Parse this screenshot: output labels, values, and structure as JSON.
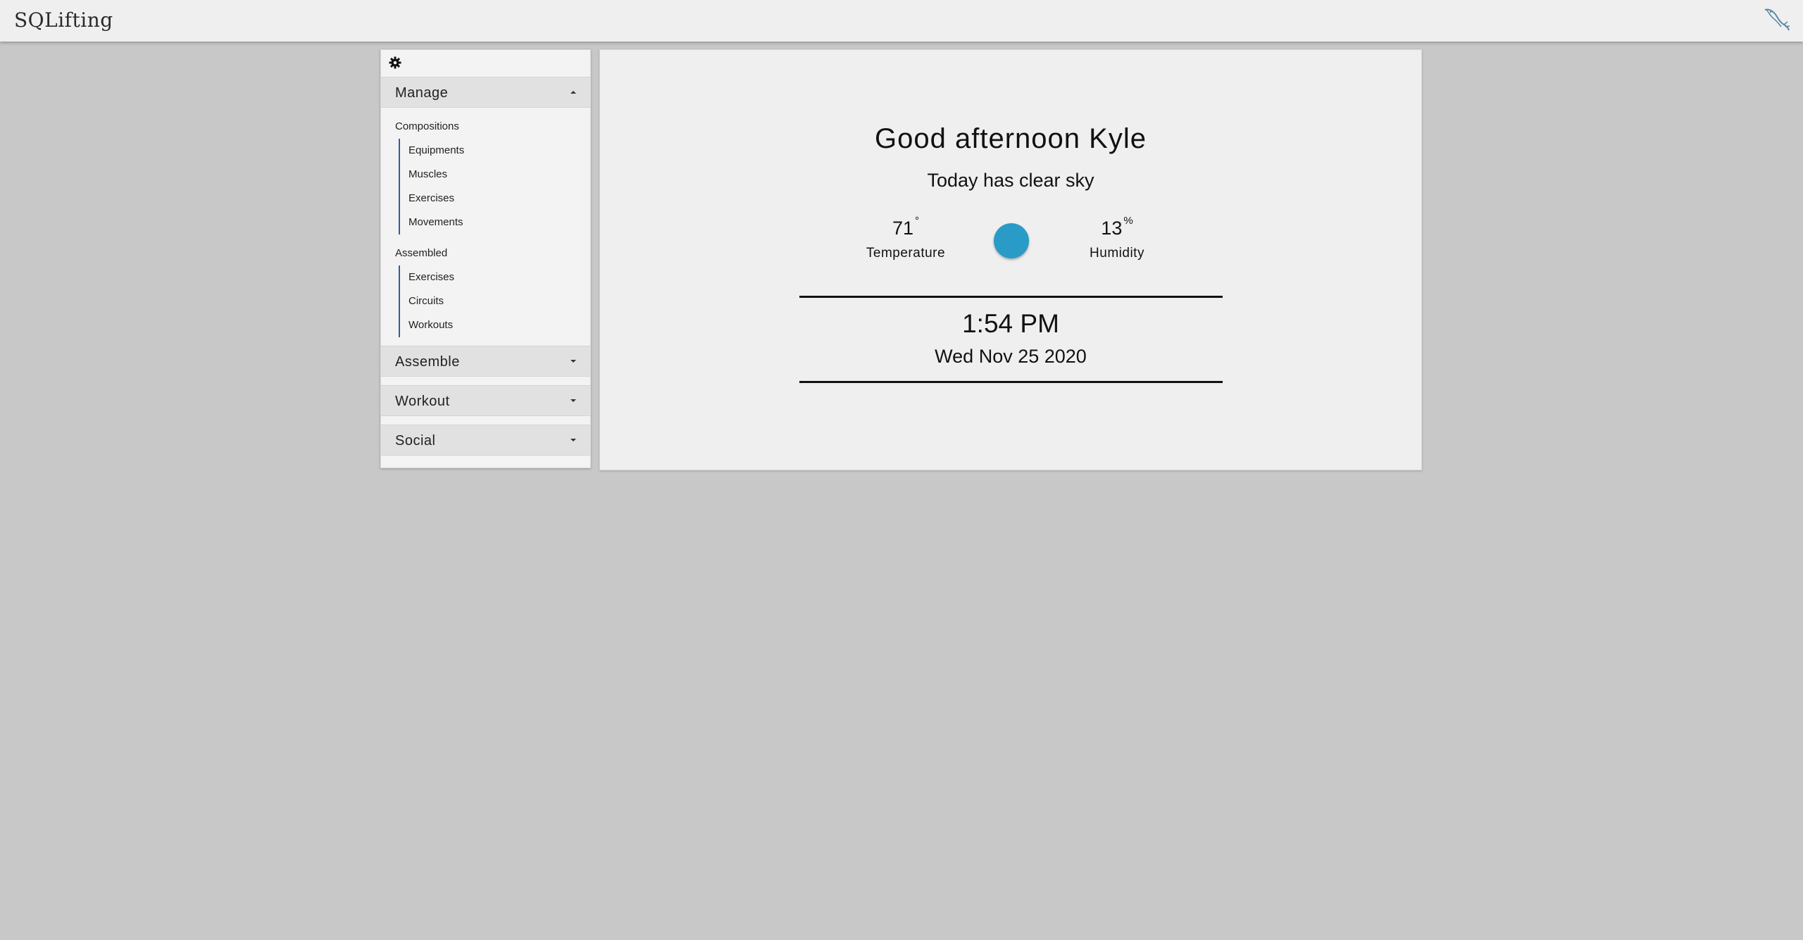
{
  "app": {
    "brand": "SQLifting"
  },
  "sidebar": {
    "sections": [
      {
        "label": "Manage",
        "expanded": true
      },
      {
        "label": "Assemble",
        "expanded": false
      },
      {
        "label": "Workout",
        "expanded": false
      },
      {
        "label": "Social",
        "expanded": false
      }
    ],
    "manage": {
      "compositions_title": "Compositions",
      "compositions": [
        "Equipments",
        "Muscles",
        "Exercises",
        "Movements"
      ],
      "assembled_title": "Assembled",
      "assembled": [
        "Exercises",
        "Circuits",
        "Workouts"
      ]
    }
  },
  "dashboard": {
    "greeting": "Good afternoon Kyle",
    "condition": "Today has clear sky",
    "temperature": {
      "value": "71",
      "unit": "°",
      "label": "Temperature"
    },
    "humidity": {
      "value": "13",
      "unit": "%",
      "label": "Humidity"
    },
    "weather_icon_color": "#2a9bc7",
    "time": "1:54 PM",
    "date": "Wed Nov 25 2020"
  },
  "icons": {
    "settings": "gear-icon",
    "database": "mysql-dolphin-icon"
  }
}
